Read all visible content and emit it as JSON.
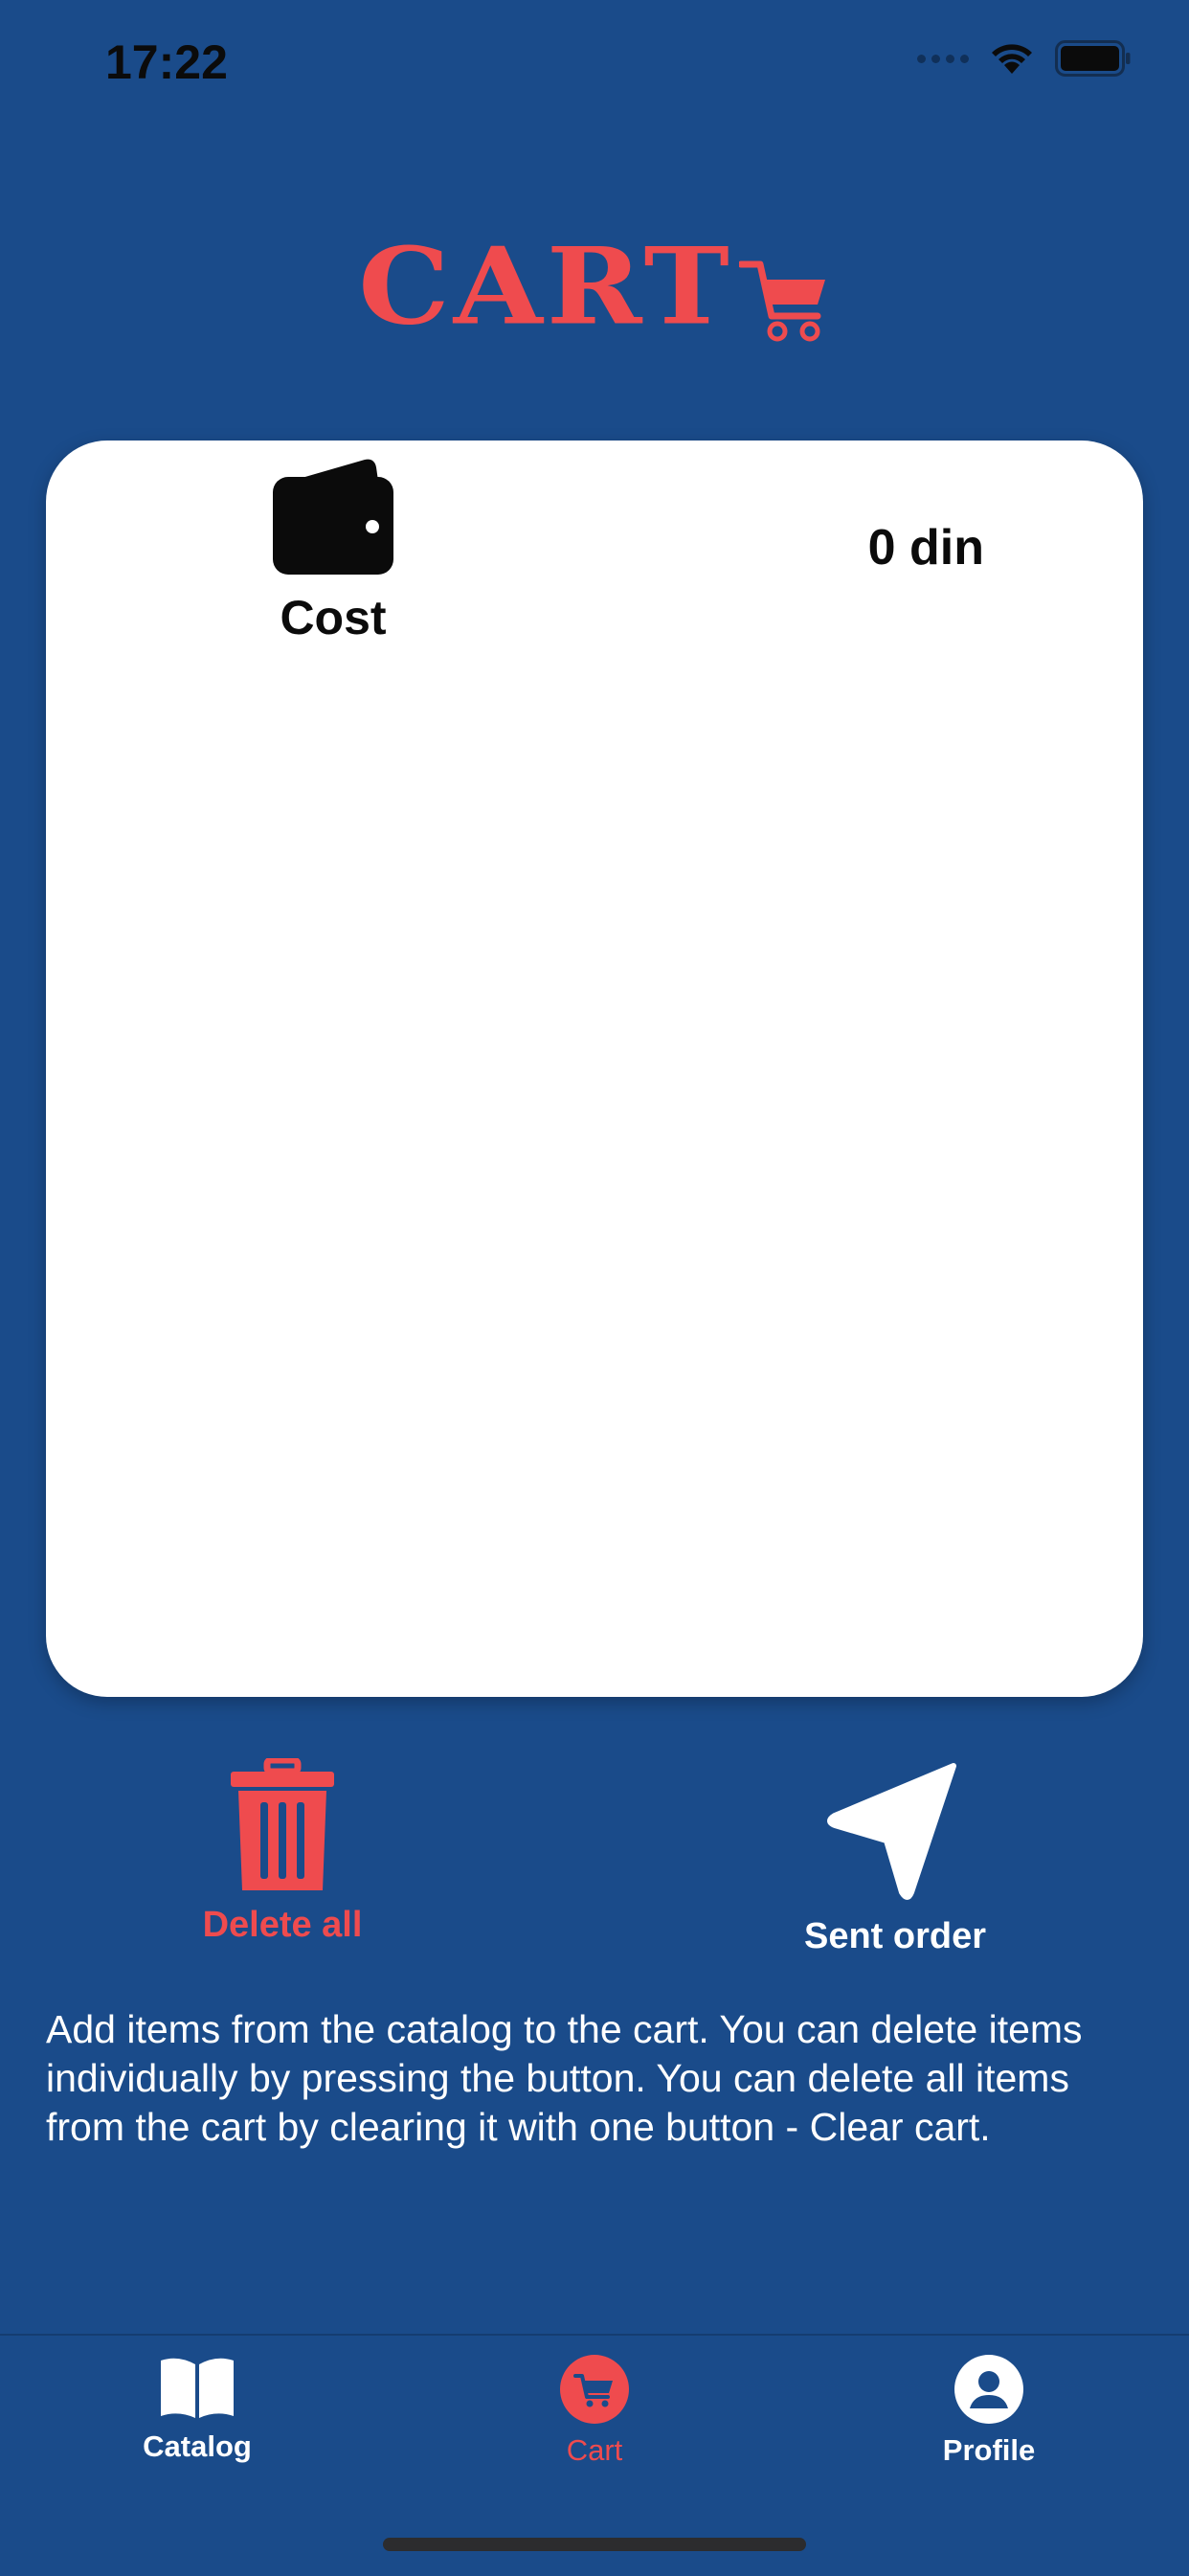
{
  "status_bar": {
    "time": "17:22",
    "icons": [
      "signal-dots-icon",
      "wifi-icon",
      "battery-icon"
    ]
  },
  "header": {
    "title": "CART",
    "icon": "shopping-cart-icon"
  },
  "cart_card": {
    "cost_icon": "wallet-icon",
    "cost_label": "Cost",
    "total": "0 din"
  },
  "actions": {
    "delete_all_label": "Delete all",
    "delete_icon": "trash-icon",
    "send_order_label": "Sent order",
    "send_icon": "send-arrow-icon"
  },
  "help_text": "Add items from the catalog to the cart. You can delete items individually by pressing the button. You can delete all items from the cart by clearing it with one button - Clear cart.",
  "tabs": [
    {
      "label": "Catalog",
      "icon": "book-icon",
      "active": false
    },
    {
      "label": "Cart",
      "icon": "cart-icon",
      "active": true
    },
    {
      "label": "Profile",
      "icon": "user-icon",
      "active": false
    }
  ],
  "colors": {
    "background": "#1a4b8a",
    "accent": "#ef4b4e",
    "card": "#ffffff"
  }
}
